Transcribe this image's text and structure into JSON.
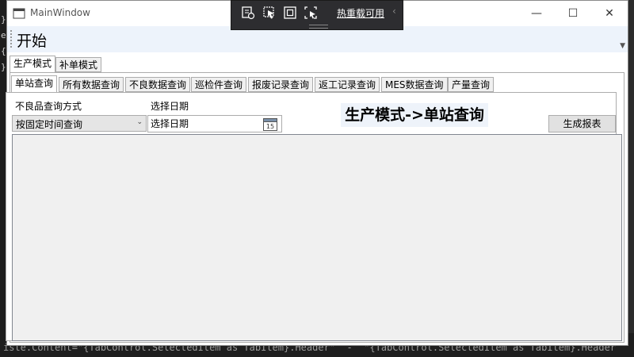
{
  "window": {
    "title": "MainWindow",
    "controls": {
      "minimize": "—",
      "maximize": "☐",
      "close": "✕"
    }
  },
  "hot_reload_toolbar": {
    "label": "热重载可用",
    "icons": [
      "live-visual-tree-icon",
      "select-element-icon",
      "display-adorners-icon",
      "track-focus-icon"
    ]
  },
  "menu": {
    "start_label": "开始"
  },
  "mode_tabs": [
    {
      "label": "生产模式",
      "selected": true
    },
    {
      "label": "补单模式",
      "selected": false
    }
  ],
  "sub_tabs": [
    {
      "label": "单站查询",
      "selected": true
    },
    {
      "label": "所有数据查询",
      "selected": false
    },
    {
      "label": "不良数据查询",
      "selected": false
    },
    {
      "label": "巡检件查询",
      "selected": false
    },
    {
      "label": "报废记录查询",
      "selected": false
    },
    {
      "label": "返工记录查询",
      "selected": false
    },
    {
      "label": "MES数据查询",
      "selected": false
    },
    {
      "label": "产量查询",
      "selected": false
    }
  ],
  "query_form": {
    "defect_query_label": "不良品查询方式",
    "defect_query_value": "按固定时间查询",
    "date_label": "选择日期",
    "date_placeholder": "选择日期",
    "calendar_day": "15"
  },
  "page_heading": "生产模式->单站查询",
  "generate_report_label": "生成报表",
  "background_code": "iste.Content=\"{TabControl.SelectedItem as TabItem}.Header\"  -  \"{TabControl.SelectedItem as TabItem}.Header",
  "colors": {
    "menu_bar": "#edf3fb",
    "heading_bg": "#eef3fa",
    "overlay_bg": "#2d2d30",
    "grid_bg": "#f0f0f0"
  }
}
